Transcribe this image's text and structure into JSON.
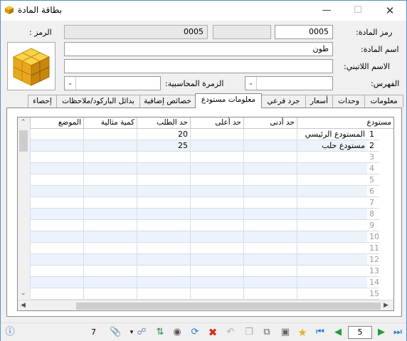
{
  "window": {
    "title": "بطاقة المادة"
  },
  "form": {
    "code_label": "رمز المادة:",
    "code_value": "0005",
    "symbol_label": "الرمز :",
    "symbol_value": "0005",
    "name_label": "اسم المادة:",
    "name_value": "طون",
    "latin_label": "الاسم اللاتيني:",
    "latin_value": "",
    "index_label": "الفهرس:",
    "index_value": "",
    "accounting_group_label": "الزمرة المحاسبية:",
    "accounting_group_value": ""
  },
  "tabs": [
    {
      "label": "معلومات"
    },
    {
      "label": "وحدات"
    },
    {
      "label": "أسعار"
    },
    {
      "label": "جرد فرعي"
    },
    {
      "label": "معلومات مستودع"
    },
    {
      "label": "خصائص إضافية"
    },
    {
      "label": "بدائل الباركود/ملاحظات"
    },
    {
      "label": "إحصاء"
    }
  ],
  "grid": {
    "columns": [
      "مستودع",
      "حد أدنى",
      "حد أعلى",
      "حد الطلب",
      "كمية مثالية",
      "الموضع"
    ],
    "rows": [
      {
        "num": "1",
        "warehouse": "المستودع الرئيسي",
        "min": "",
        "max": "",
        "reorder": "20",
        "ideal": "",
        "location": ""
      },
      {
        "num": "2",
        "warehouse": "مستودع حلب",
        "min": "",
        "max": "",
        "reorder": "25",
        "ideal": "",
        "location": ""
      },
      {
        "num": "3"
      },
      {
        "num": "4"
      },
      {
        "num": "5"
      },
      {
        "num": "6"
      },
      {
        "num": "7"
      },
      {
        "num": "8"
      },
      {
        "num": "9"
      },
      {
        "num": "10"
      },
      {
        "num": "11"
      },
      {
        "num": "12"
      },
      {
        "num": "13"
      },
      {
        "num": "14"
      },
      {
        "num": "15"
      }
    ]
  },
  "statusbar": {
    "count": "7",
    "page": "5",
    "icons": [
      "info-icon",
      "attachment-icon",
      "link-icon",
      "sort-icon",
      "view-icon",
      "refresh-icon",
      "delete-icon",
      "undo-icon",
      "copy-icon",
      "paste-icon",
      "save-icon",
      "favorite-icon",
      "first-icon",
      "prev-icon",
      "next-icon",
      "last-icon"
    ]
  }
}
